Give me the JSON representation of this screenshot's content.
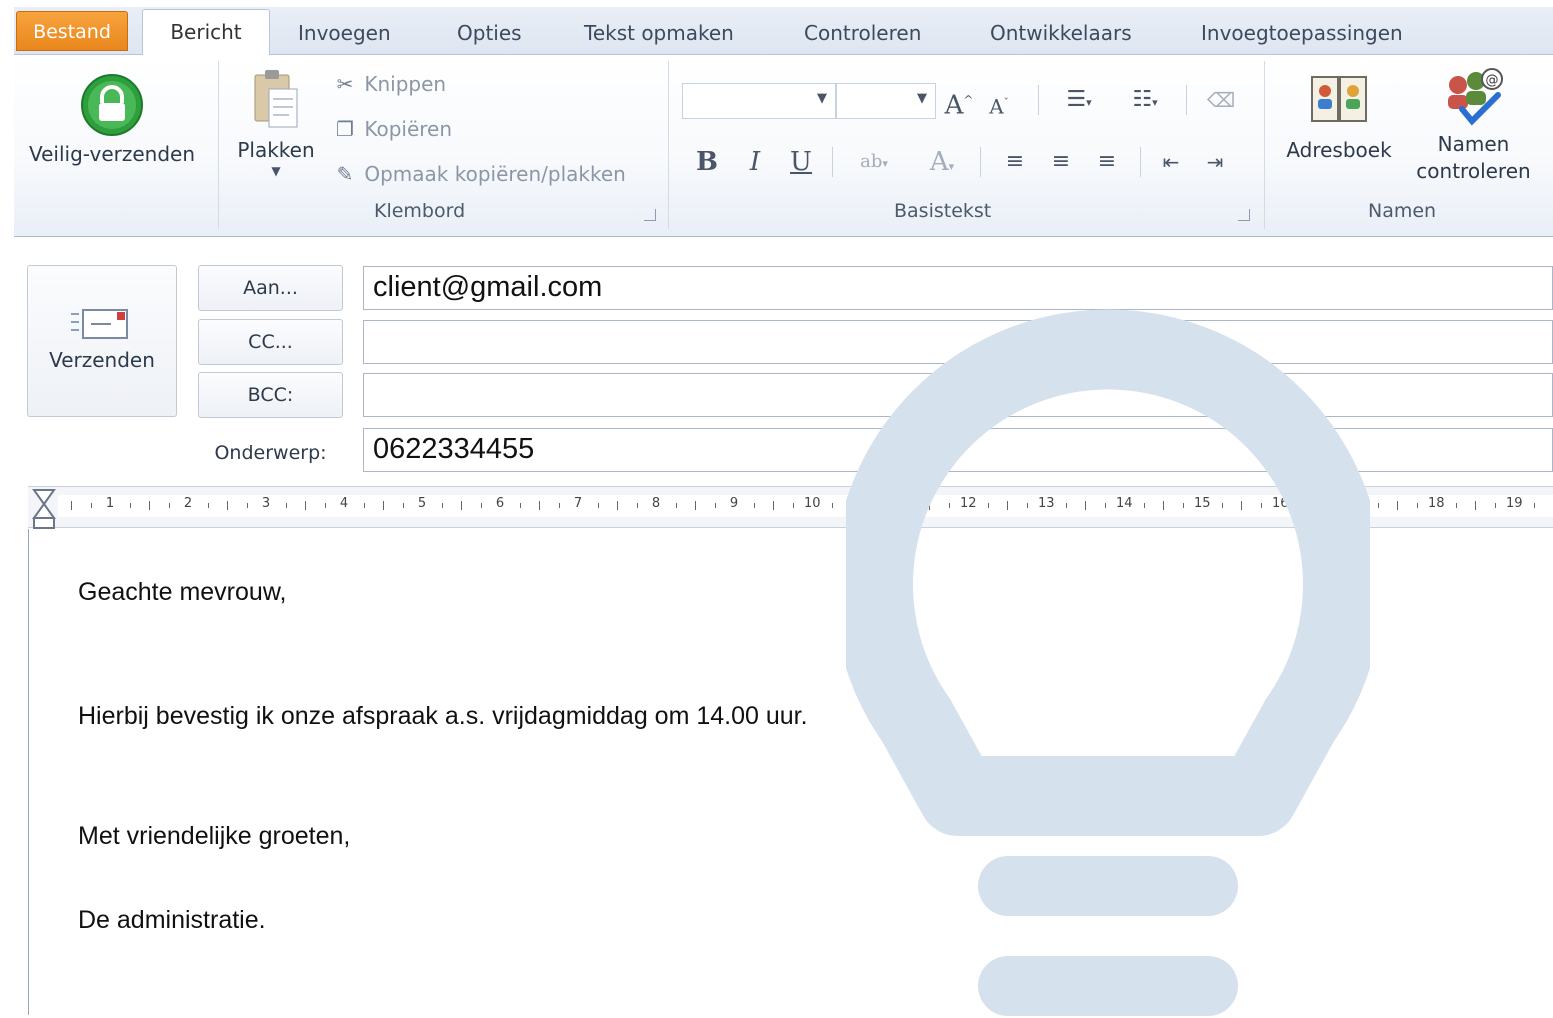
{
  "tabs": [
    "Bestand",
    "Bericht",
    "Invoegen",
    "Opties",
    "Tekst opmaken",
    "Controleren",
    "Ontwikkelaars",
    "Invoegtoepassingen"
  ],
  "ribbon": {
    "secure_send": "Veilig-verzenden",
    "paste": "Plakken",
    "cut": "Knippen",
    "copy": "Kopiëren",
    "format_painter": "Opmaak kopiëren/plakken",
    "group_clipboard": "Klembord",
    "group_basic_text": "Basistekst",
    "address_book": "Adresboek",
    "check_names_line1": "Namen",
    "check_names_line2": "controleren",
    "group_names": "Namen",
    "bold": "B",
    "italic": "I",
    "underline": "U"
  },
  "header": {
    "send": "Verzenden",
    "to_button": "Aan...",
    "cc_button": "CC...",
    "bcc_button": "BCC:",
    "subject_label": "Onderwerp:",
    "to_value": "client@gmail.com",
    "cc_value": "",
    "bcc_value": "",
    "subject_value": "0622334455"
  },
  "ruler": {
    "numbers": [
      "1",
      "2",
      "3",
      "4",
      "5",
      "6",
      "7",
      "8",
      "9",
      "10",
      "11",
      "12",
      "13",
      "14",
      "15",
      "16",
      "17",
      "18",
      "19"
    ]
  },
  "body": {
    "greeting": "Geachte mevrouw,",
    "line1": "Hierbij bevestig ik onze afspraak a.s. vrijdagmiddag om 14.00 uur.",
    "closing": "Met vriendelijke groeten,",
    "signature": "De administratie."
  },
  "colors": {
    "file_tab": "#e8871c",
    "ribbon_bg": "#f7f9fc",
    "watermark": "#d6e1ee",
    "secure_icon": "#2e9f3c"
  },
  "icons": [
    "lock-icon",
    "paste-icon",
    "scissors-icon",
    "copy-icon",
    "brush-icon",
    "address-book-icon",
    "check-names-icon",
    "envelope-icon",
    "lightbulb-icon"
  ]
}
